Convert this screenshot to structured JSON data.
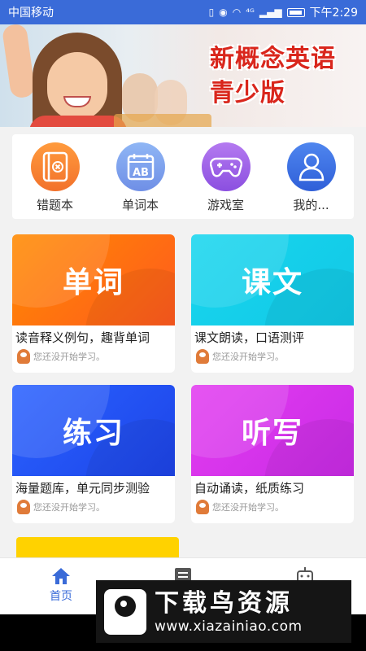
{
  "status_bar": {
    "carrier": "中国移动",
    "signal": "⁴ᴳ",
    "time": "下午2:29"
  },
  "banner": {
    "title_line1": "新概念英语",
    "title_line2": "青少版",
    "slide_count": 4,
    "active_slide": 3
  },
  "quick_actions": [
    {
      "label": "错题本",
      "icon": "error-book-icon",
      "color_from": "#ff9b3d",
      "color_to": "#f2712b"
    },
    {
      "label": "单词本",
      "icon": "calendar-ab-icon",
      "color_from": "#8fb6f5",
      "color_to": "#6f8fe6"
    },
    {
      "label": "游戏室",
      "icon": "gamepad-icon",
      "color_from": "#b47af0",
      "color_to": "#8b4fe0"
    },
    {
      "label": "我的...",
      "icon": "user-icon",
      "color_from": "#4f86ef",
      "color_to": "#2f5fd8"
    }
  ],
  "cards": [
    {
      "id": "words",
      "title": "单词",
      "desc": "读音释义例句，趣背单词",
      "progress": "您还没开始学习。",
      "color1": "#ff8a00",
      "color2": "#ff5a1f"
    },
    {
      "id": "texts",
      "title": "课文",
      "desc": "课文朗读，口语测评",
      "progress": "您还没开始学习。",
      "color1": "#18d6ee",
      "color2": "#12c8e6"
    },
    {
      "id": "practice",
      "title": "练习",
      "desc": "海量题库，单元同步测验",
      "progress": "您还没开始学习。",
      "color1": "#2a62ff",
      "color2": "#1d44e8"
    },
    {
      "id": "dictation",
      "title": "听写",
      "desc": "自动诵读，纸质练习",
      "progress": "您还没开始学习。",
      "color1": "#e33df0",
      "color2": "#c92be6"
    }
  ],
  "tabbar": {
    "home_label": "首页",
    "accent": "#3a6bd8"
  },
  "watermark": {
    "title": "下载鸟资源",
    "url": "www.xiazainiao.com"
  }
}
